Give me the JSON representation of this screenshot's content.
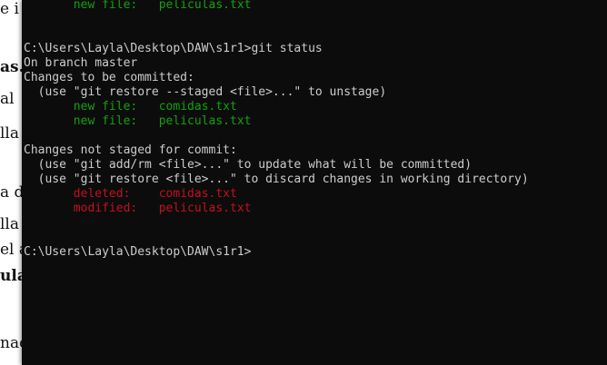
{
  "background_doc": {
    "fragments": [
      "e i",
      "as.",
      "al",
      "lla",
      "a d",
      "lla",
      "el a",
      "ula",
      "nac"
    ]
  },
  "terminal": {
    "lines": [
      {
        "indent": "       ",
        "label": "new file:",
        "gap": "   ",
        "file": "peliculas.txt",
        "color": "green"
      },
      {
        "text": "C:\\Users\\Layla\\Desktop\\DAW\\s1r1>git status"
      },
      {
        "text": "On branch master"
      },
      {
        "text": "Changes to be committed:"
      },
      {
        "text": "  (use \"git restore --staged <file>...\" to unstage)"
      },
      {
        "indent": "       ",
        "label": "new file:",
        "gap": "   ",
        "file": "comidas.txt",
        "color": "green"
      },
      {
        "indent": "       ",
        "label": "new file:",
        "gap": "   ",
        "file": "peliculas.txt",
        "color": "green"
      },
      {
        "text": "Changes not staged for commit:"
      },
      {
        "text": "  (use \"git add/rm <file>...\" to update what will be committed)"
      },
      {
        "text": "  (use \"git restore <file>...\" to discard changes in working directory)"
      },
      {
        "indent": "       ",
        "label": "deleted:",
        "gap": "    ",
        "file": "comidas.txt",
        "color": "red"
      },
      {
        "indent": "       ",
        "label": "modified:",
        "gap": "   ",
        "file": "peliculas.txt",
        "color": "red"
      },
      {
        "text": "C:\\Users\\Layla\\Desktop\\DAW\\s1r1>"
      }
    ]
  },
  "colors": {
    "terminal_bg": "#0c0c0c",
    "terminal_fg": "#cccccc",
    "staged": "#13a10e",
    "unstaged": "#c50f1f"
  }
}
